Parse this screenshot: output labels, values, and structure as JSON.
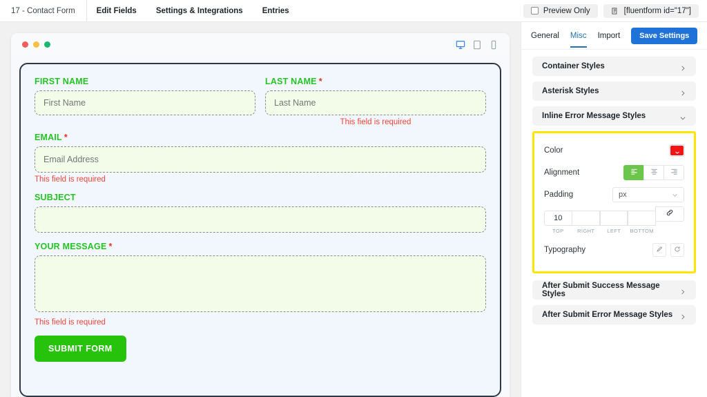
{
  "topbar": {
    "form_title": "17 - Contact Form",
    "nav": [
      {
        "label": "Edit Fields"
      },
      {
        "label": "Settings & Integrations"
      },
      {
        "label": "Entries"
      }
    ],
    "preview_only_label": "Preview Only",
    "preview_only_checked": false,
    "shortcode": "[fluentform id=\"17\"]",
    "shortcode_icon": "copy-icon"
  },
  "preview": {
    "window_dots": [
      "#f25c5c",
      "#f8bf40",
      "#19b871"
    ],
    "devices": [
      {
        "name": "desktop",
        "icon": "desktop-icon",
        "active": true
      },
      {
        "name": "tablet",
        "icon": "tablet-icon",
        "active": false
      },
      {
        "name": "mobile",
        "icon": "mobile-icon",
        "active": false
      }
    ],
    "form": {
      "first_name": {
        "label": "FIRST NAME",
        "required": false,
        "placeholder": "First Name",
        "value": "",
        "error": ""
      },
      "last_name": {
        "label": "LAST NAME",
        "required": true,
        "required_mark": "*",
        "placeholder": "Last Name",
        "value": "",
        "error": "This field is required"
      },
      "email": {
        "label": "EMAIL",
        "required": true,
        "required_mark": "*",
        "placeholder": "Email Address",
        "value": "",
        "error": "This field is required"
      },
      "subject": {
        "label": "SUBJECT",
        "required": false,
        "placeholder": "",
        "value": "",
        "error": ""
      },
      "message": {
        "label": "YOUR MESSAGE",
        "required": true,
        "required_mark": "*",
        "placeholder": "",
        "value": "",
        "error": "This field is required"
      },
      "submit_label": "SUBMIT FORM",
      "label_color": "#24c424",
      "error_color": "#f0453a",
      "input_bg": "#f3fce9",
      "submit_bg": "#27c20b",
      "card_border": "#2d3748",
      "card_bg": "#f2f6fd"
    }
  },
  "sidebar": {
    "tabs": [
      {
        "label": "General",
        "active": false
      },
      {
        "label": "Misc",
        "active": true
      },
      {
        "label": "Import",
        "active": false
      }
    ],
    "save_label": "Save Settings",
    "save_color": "#1f73d8",
    "accordions_top": [
      {
        "label": "Container Styles",
        "state": "collapsed",
        "icon": "chevron-right-icon"
      },
      {
        "label": "Asterisk Styles",
        "state": "collapsed",
        "icon": "chevron-right-icon"
      },
      {
        "label": "Inline Error Message Styles",
        "state": "expanded",
        "icon": "chevron-down-icon"
      }
    ],
    "accordions_bottom": [
      {
        "label": "After Submit Success Message Styles",
        "state": "collapsed",
        "icon": "chevron-right-icon"
      },
      {
        "label": "After Submit Error Message Styles",
        "state": "collapsed",
        "icon": "chevron-right-icon"
      }
    ],
    "panel": {
      "highlight_color": "#ffe600",
      "color": {
        "label": "Color",
        "value": "#f31515",
        "icon": "color-swatch-chevron-icon"
      },
      "alignment": {
        "label": "Alignment",
        "selected": "left",
        "active_color": "#6cc64b",
        "options": [
          {
            "name": "align-left",
            "icon": "align-left-icon",
            "active": true
          },
          {
            "name": "align-center",
            "icon": "align-center-icon",
            "active": false
          },
          {
            "name": "align-right",
            "icon": "align-right-icon",
            "active": false
          }
        ]
      },
      "padding": {
        "label": "Padding",
        "unit": "px",
        "unit_icon": "chevron-down-icon",
        "link_icon": "link-icon",
        "linked": true,
        "fields": [
          {
            "tag": "TOP",
            "value": "10"
          },
          {
            "tag": "RIGHT",
            "value": ""
          },
          {
            "tag": "LEFT",
            "value": ""
          },
          {
            "tag": "BOTTOM",
            "value": ""
          }
        ]
      },
      "typography": {
        "label": "Typography",
        "buttons": [
          {
            "name": "edit",
            "icon": "pencil-icon"
          },
          {
            "name": "reset",
            "icon": "reset-icon"
          }
        ]
      }
    }
  }
}
